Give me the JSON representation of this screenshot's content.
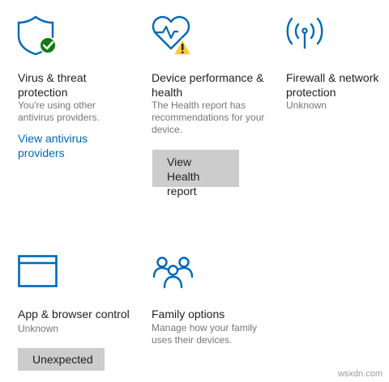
{
  "colors": {
    "accent": "#0067b8",
    "check_green": "#107c10",
    "warning_yellow": "#ffc83d",
    "button_bg": "#cccccc",
    "secondary_text": "#767676"
  },
  "tiles": [
    {
      "icon": "shield-check-icon",
      "title": "Virus & threat protection",
      "desc": "You're using other antivirus providers.",
      "link": "View antivirus providers"
    },
    {
      "icon": "heart-warning-icon",
      "title": "Device performance & health",
      "desc": "The Health report has recommendations for your device.",
      "button": "View Health report"
    },
    {
      "icon": "wifi-antenna-icon",
      "title": "Firewall & network protection",
      "desc": "Unknown"
    },
    {
      "icon": "browser-window-icon",
      "title": "App & browser control",
      "desc": "Unknown",
      "button": "Unexpected"
    },
    {
      "icon": "family-icon",
      "title": "Family options",
      "desc": "Manage how your family uses their devices."
    }
  ],
  "watermark": "wsxdn.com"
}
